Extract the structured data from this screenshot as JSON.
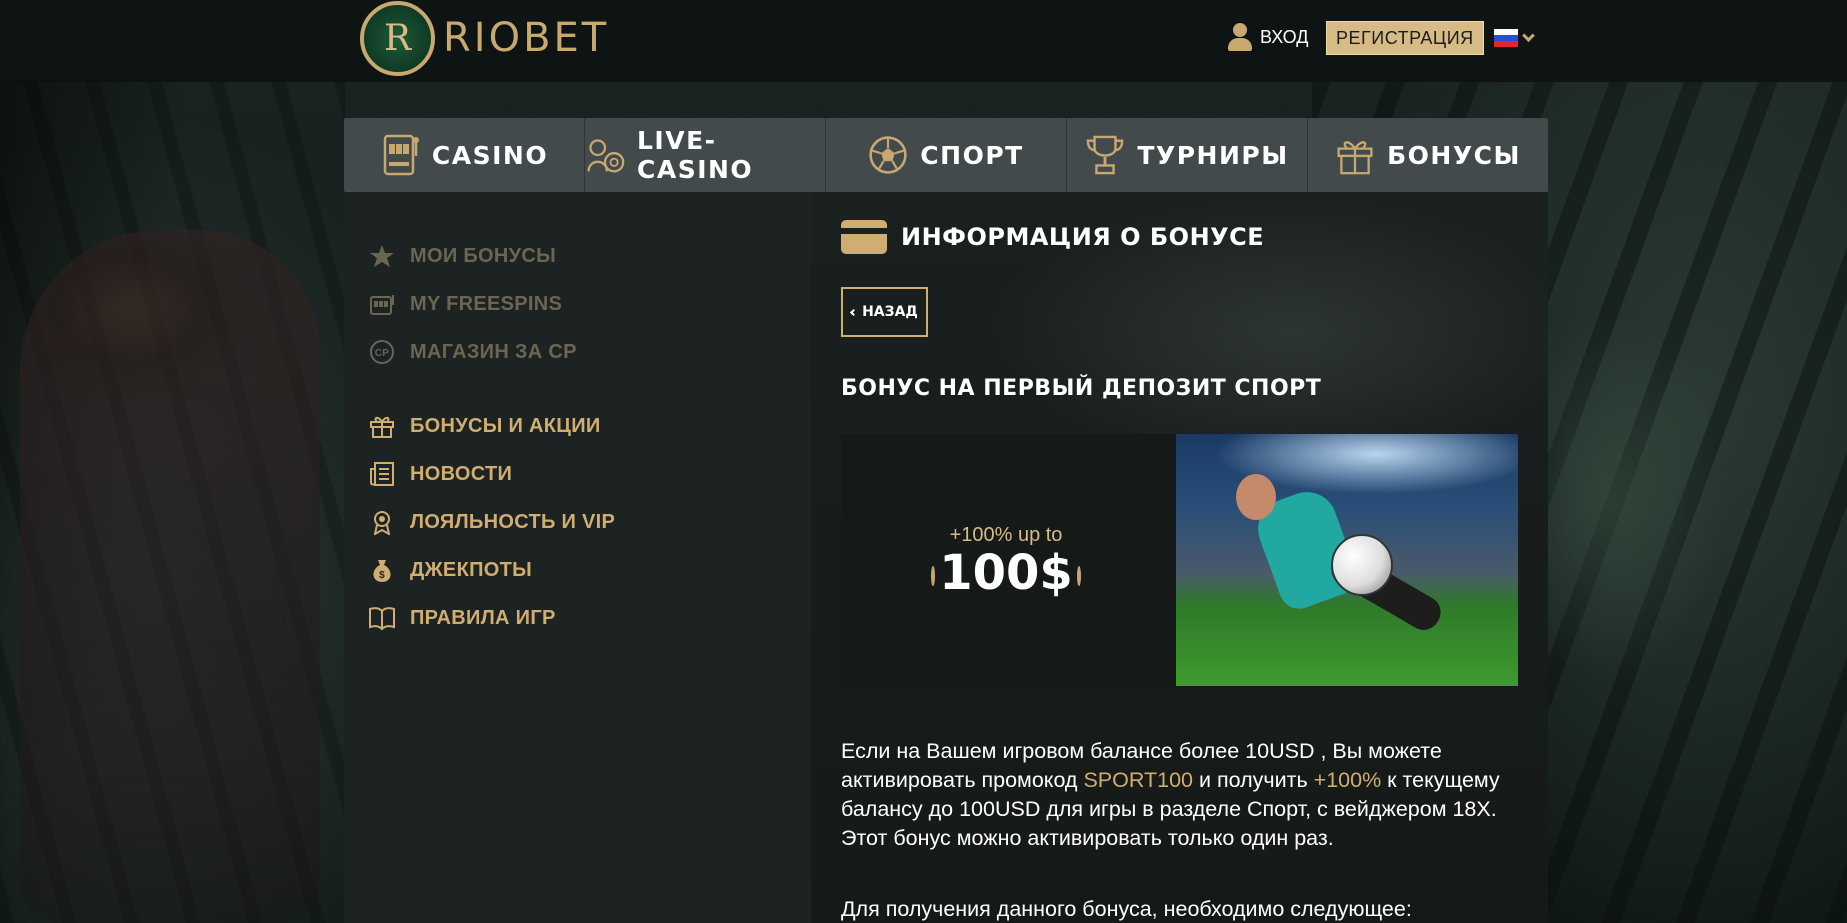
{
  "header": {
    "brand": "RIOBET",
    "login_label": "ВХОД",
    "register_label": "РЕГИСТРАЦИЯ",
    "language_flag": "russian-flag-icon"
  },
  "main_nav": {
    "items": [
      {
        "label": "CASINO",
        "icon": "slot-machine-icon"
      },
      {
        "label": "LIVE-CASINO",
        "icon": "live-dealer-icon"
      },
      {
        "label": "СПОРТ",
        "icon": "soccer-ball-icon"
      },
      {
        "label": "ТУРНИРЫ",
        "icon": "trophy-icon"
      },
      {
        "label": "БОНУСЫ",
        "icon": "gift-icon"
      }
    ]
  },
  "sidebar": {
    "items": [
      {
        "label": "МОИ БОНУСЫ",
        "icon": "star-icon"
      },
      {
        "label": "MY FREESPINS",
        "icon": "slot-machine-icon"
      },
      {
        "label": "МАГАЗИН ЗА СР",
        "icon": "cp-coin-icon"
      },
      {
        "label": "БОНУСЫ И АКЦИИ",
        "icon": "gift-icon"
      },
      {
        "label": "НОВОСТИ",
        "icon": "news-icon"
      },
      {
        "label": "ЛОЯЛЬНОСТЬ И VIP",
        "icon": "award-icon"
      },
      {
        "label": "ДЖЕКПОТЫ",
        "icon": "money-bag-icon"
      },
      {
        "label": "ПРАВИЛА ИГР",
        "icon": "book-icon"
      }
    ]
  },
  "content": {
    "title": "ИНФОРМАЦИЯ О БОНУСЕ",
    "back_label": "НАЗАД",
    "bonus_title": "БОНУС НА ПЕРВЫЙ ДЕПОЗИТ СПОРТ",
    "promo_sub": "+100% up to",
    "promo_amount": "100$",
    "text_1": "Если на Вашем игровом балансе более 10USD , Вы можете активировать промокод ",
    "promo_code": "SPORT100",
    "text_2": " и получить ",
    "percent": "+100%",
    "text_3": " к текущему балансу до 100USD для игры в разделе Спорт, с вейджером 18Х. Этот бонус можно активировать только один раз.",
    "text_4": "Для получения данного бонуса, необходимо следующее:"
  },
  "colors": {
    "accent": "#d0ad70",
    "nav_bg": "#424a4c",
    "sidebar_bg": "#1d2222"
  }
}
